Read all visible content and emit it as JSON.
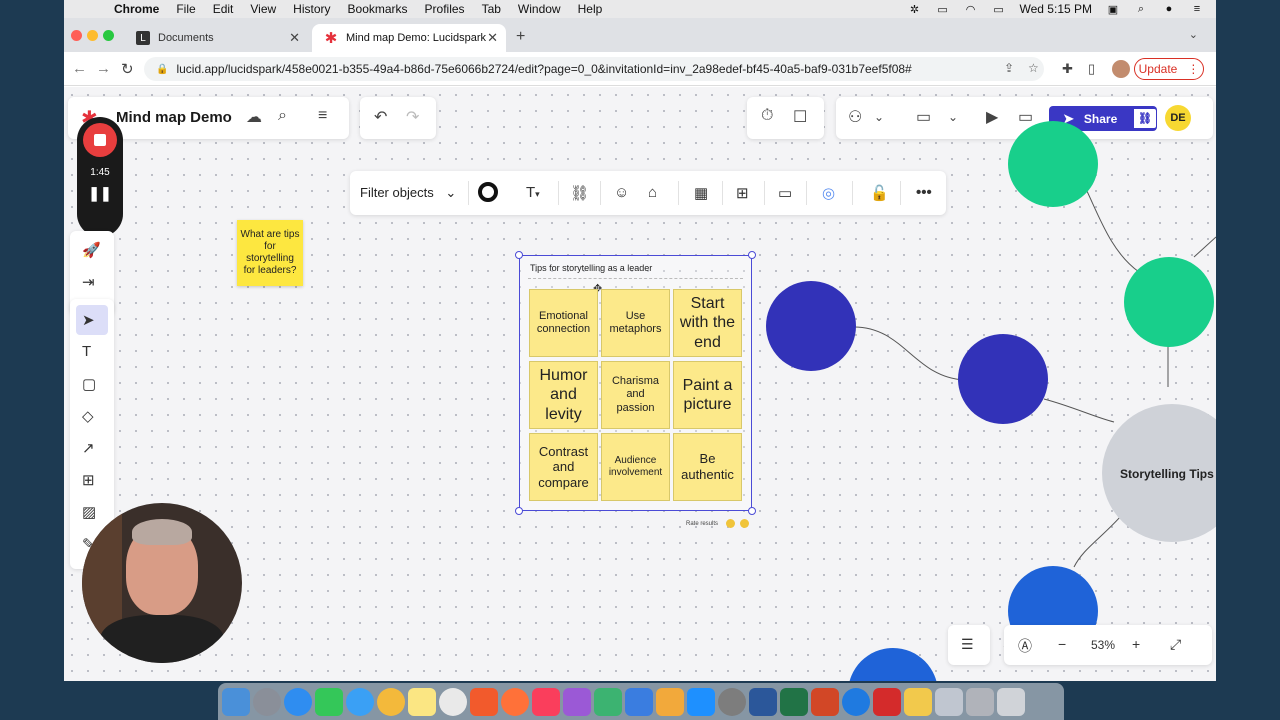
{
  "menubar": {
    "app": "Chrome",
    "items": [
      "File",
      "Edit",
      "View",
      "History",
      "Bookmarks",
      "Profiles",
      "Tab",
      "Window",
      "Help"
    ],
    "clock": "Wed 5:15 PM"
  },
  "tabs": [
    {
      "title": "Documents"
    },
    {
      "title": "Mind map Demo: Lucidspark"
    }
  ],
  "address": {
    "url": "lucid.app/lucidspark/458e0021-b355-49a4-b86d-75e6066b2724/edit?page=0_0&invitationId=inv_2a98edef-bf45-40a5-baf9-031b7eef5f08#"
  },
  "browser": {
    "update_label": "Update"
  },
  "document": {
    "title": "Mind map Demo"
  },
  "recorder": {
    "time": "1:45"
  },
  "toolbar": {
    "filter_label": "Filter objects",
    "text_label": "T"
  },
  "share": {
    "label": "Share"
  },
  "avatar": {
    "initials": "DE"
  },
  "question_note": {
    "text": "What are tips for storytelling for leaders?"
  },
  "container": {
    "title": "Tips for storytelling as a leader",
    "rate_label": "Rate results",
    "notes": [
      {
        "text": "Emotional connection",
        "size": "small"
      },
      {
        "text": "Use metaphors",
        "size": "small"
      },
      {
        "text": "Start with the end",
        "size": "large"
      },
      {
        "text": "Humor and levity",
        "size": "large"
      },
      {
        "text": "Charisma and passion",
        "size": "small"
      },
      {
        "text": "Paint a picture",
        "size": "large"
      },
      {
        "text": "Contrast and compare",
        "size": "medium"
      },
      {
        "text": "Audience involvement",
        "size": "tiny"
      },
      {
        "text": "Be authentic",
        "size": "medium"
      }
    ]
  },
  "mindmap": {
    "central_label": "Storytelling Tips",
    "colors": {
      "central": "#cfd2d8",
      "navy": "#3232b8",
      "green": "#18cf8b",
      "blue": "#1f63d8"
    }
  },
  "zoom": {
    "level": "53%"
  },
  "colors": {
    "accent": "#3a37c4",
    "sticky": "#fce98a",
    "selection": "#4b4bd6",
    "record": "#e83e3e"
  }
}
